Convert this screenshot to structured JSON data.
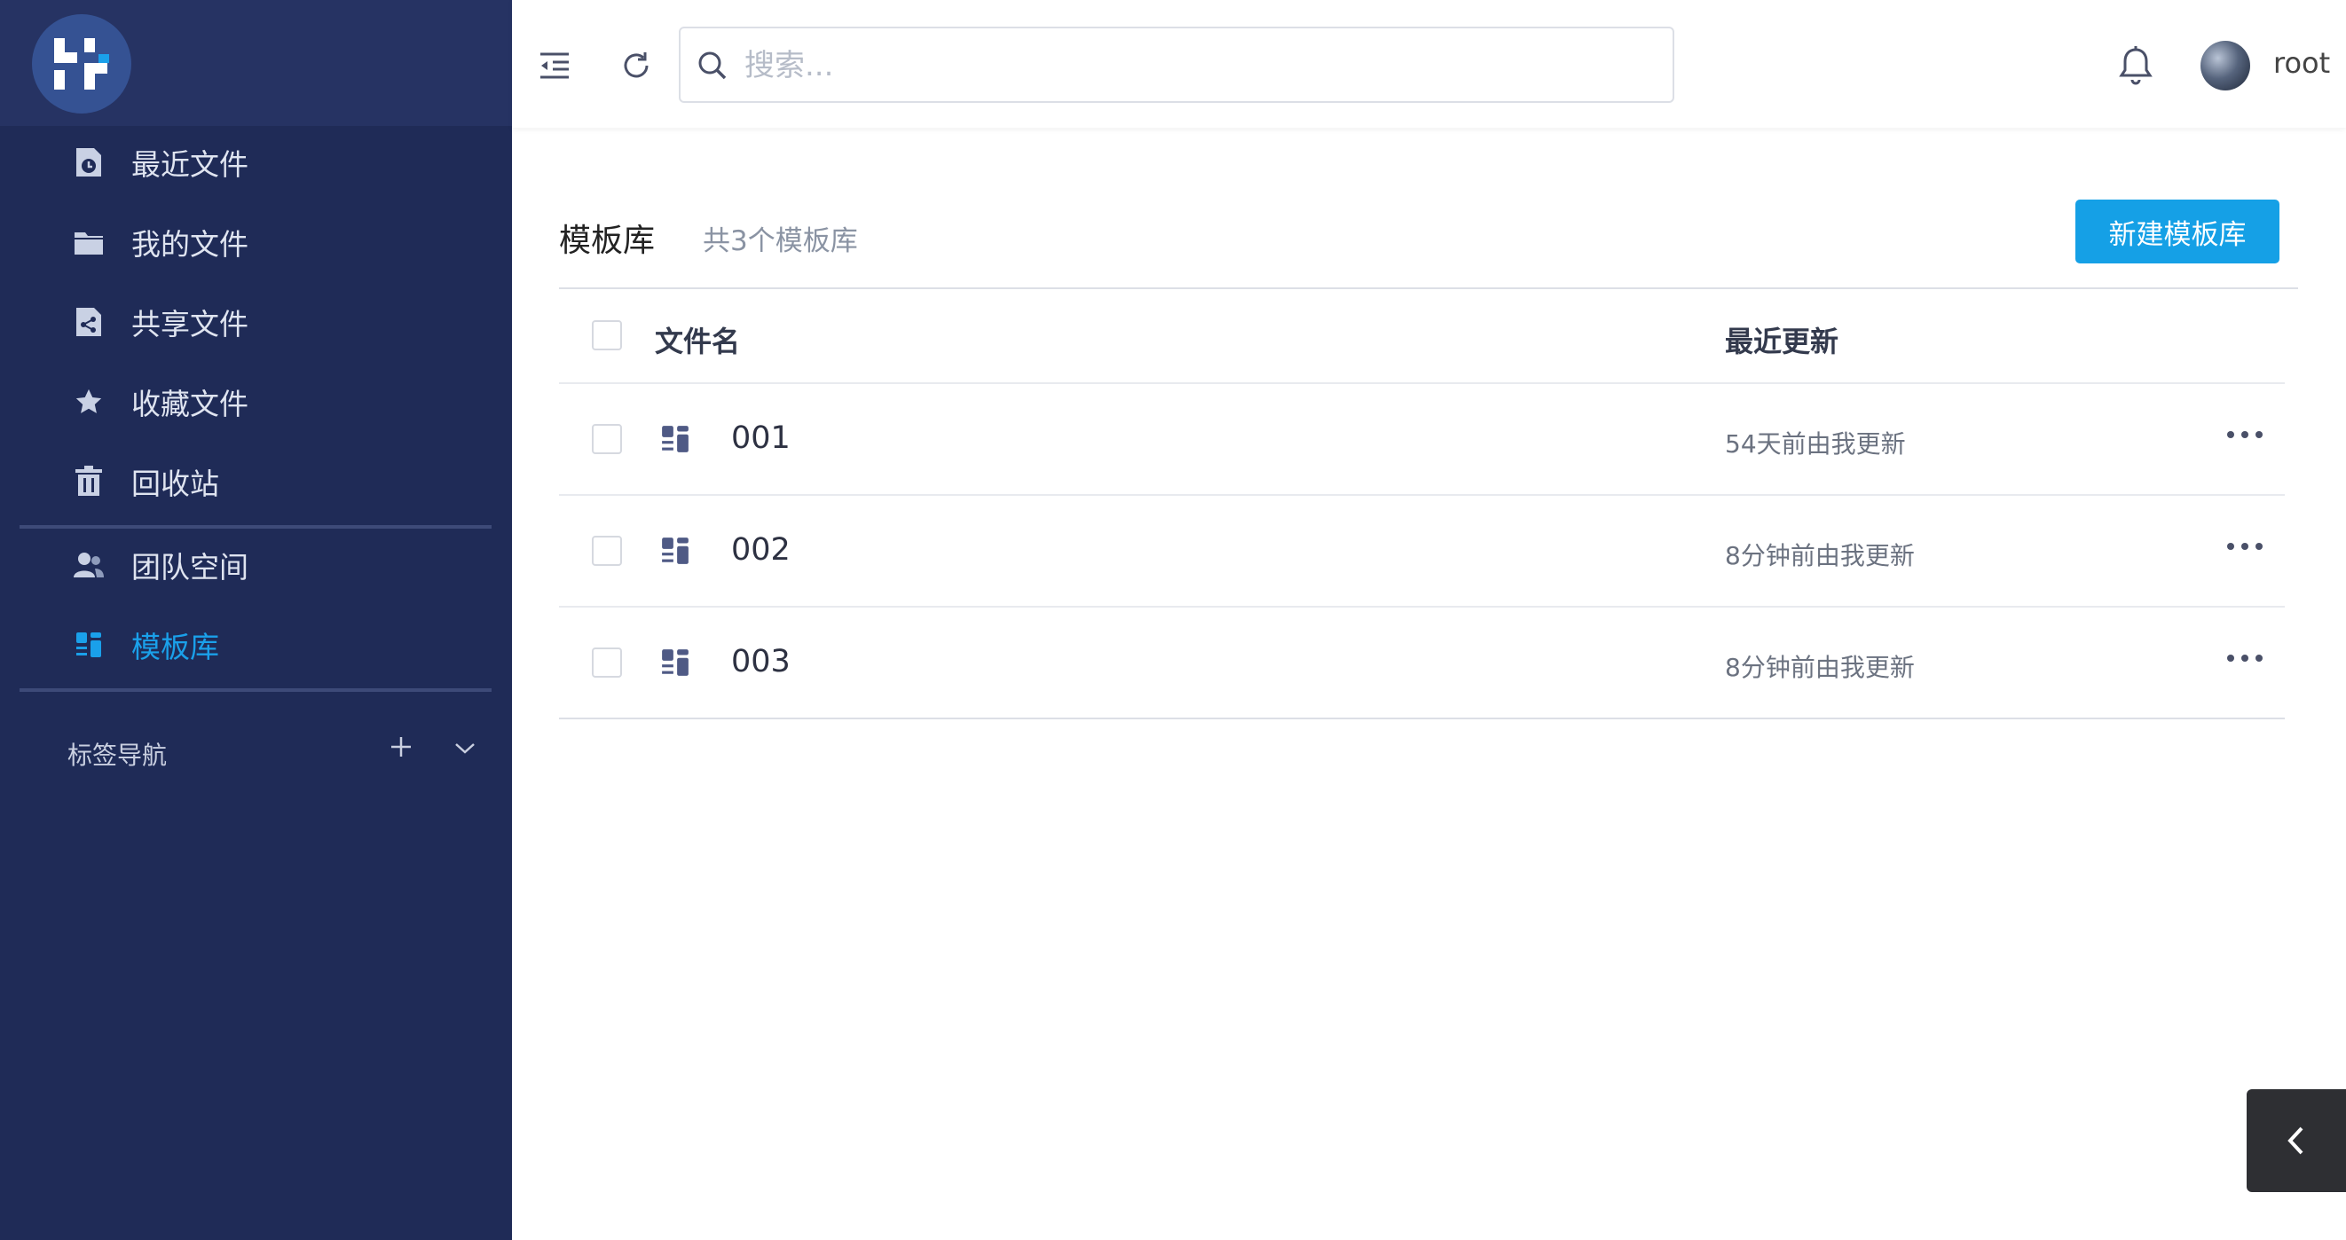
{
  "sidebar": {
    "items": [
      {
        "label": "最近文件",
        "icon": "recent-file-icon"
      },
      {
        "label": "我的文件",
        "icon": "folder-icon"
      },
      {
        "label": "共享文件",
        "icon": "shared-file-icon"
      },
      {
        "label": "收藏文件",
        "icon": "star-icon"
      },
      {
        "label": "回收站",
        "icon": "trash-icon"
      },
      {
        "label": "团队空间",
        "icon": "team-icon"
      },
      {
        "label": "模板库",
        "icon": "template-icon"
      }
    ],
    "active_item": "模板库",
    "tag_nav": {
      "title": "标签导航"
    }
  },
  "header": {
    "search_placeholder": "搜索...",
    "username": "root"
  },
  "main": {
    "title": "模板库",
    "count_text": "共3个模板库",
    "new_button_label": "新建模板库",
    "columns": {
      "name": "文件名",
      "updated": "最近更新"
    },
    "rows": [
      {
        "name": "001",
        "updated": "54天前由我更新"
      },
      {
        "name": "002",
        "updated": "8分钟前由我更新"
      },
      {
        "name": "003",
        "updated": "8分钟前由我更新"
      }
    ]
  },
  "colors": {
    "sidebar_bg": "#1f2b57",
    "accent": "#15a0e6",
    "active_text": "#1aa0ea"
  }
}
